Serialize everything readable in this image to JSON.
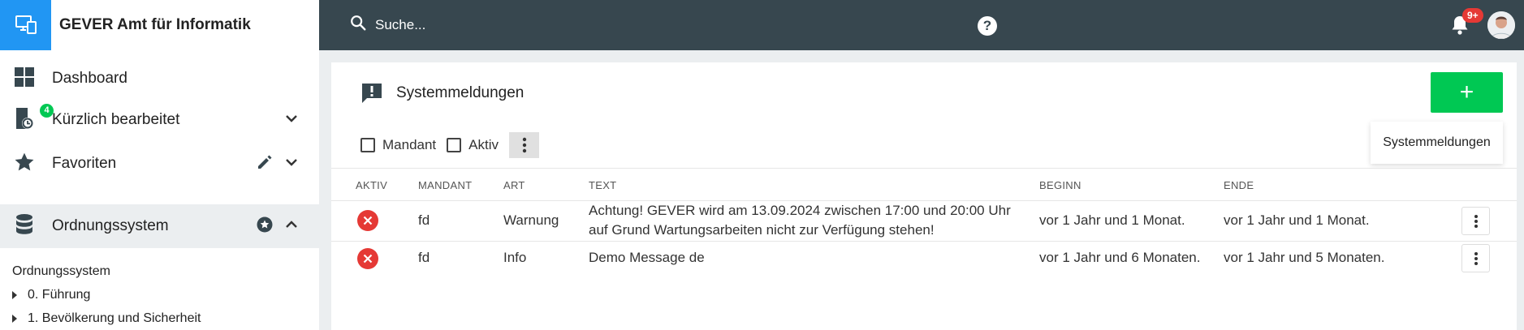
{
  "app": {
    "title": "GEVER Amt für Informatik"
  },
  "topbar": {
    "search_placeholder": "Suche...",
    "help_label": "?",
    "notification_count": "9+"
  },
  "sidebar": {
    "items": [
      {
        "label": "Dashboard"
      },
      {
        "label": "Kürzlich bearbeitet",
        "badge": "4"
      },
      {
        "label": "Favoriten"
      },
      {
        "label": "Ordnungssystem"
      }
    ],
    "tree": {
      "title": "Ordnungssystem",
      "items": [
        "0. Führung",
        "1. Bevölkerung und Sicherheit"
      ]
    }
  },
  "main": {
    "title": "Systemmeldungen",
    "add_button_label": "+",
    "add_tooltip": "Systemmeldungen",
    "filters": [
      {
        "label": "Mandant",
        "checked": false
      },
      {
        "label": "Aktiv",
        "checked": false
      }
    ],
    "table": {
      "columns": [
        "AKTIV",
        "MANDANT",
        "ART",
        "TEXT",
        "BEGINN",
        "ENDE"
      ],
      "rows": [
        {
          "aktiv": false,
          "mandant": "fd",
          "art": "Warnung",
          "text_line1": "Achtung! GEVER wird am 13.09.2024 zwischen 17:00 und 20:00 Uhr",
          "text_line2": "auf Grund Wartungsarbeiten nicht zur Verfügung stehen!",
          "beginn": "vor 1 Jahr und 1 Monat.",
          "ende": "vor 1 Jahr und 1 Monat."
        },
        {
          "aktiv": false,
          "mandant": "fd",
          "art": "Info",
          "text_line1": "Demo Message de",
          "text_line2": "",
          "beginn": "vor 1 Jahr und 6 Monaten.",
          "ende": "vor 1 Jahr und 5 Monaten."
        }
      ]
    }
  },
  "colors": {
    "topbar": "#37474f",
    "brand": "#2196f3",
    "accent_green": "#00c853",
    "danger": "#e53935"
  }
}
